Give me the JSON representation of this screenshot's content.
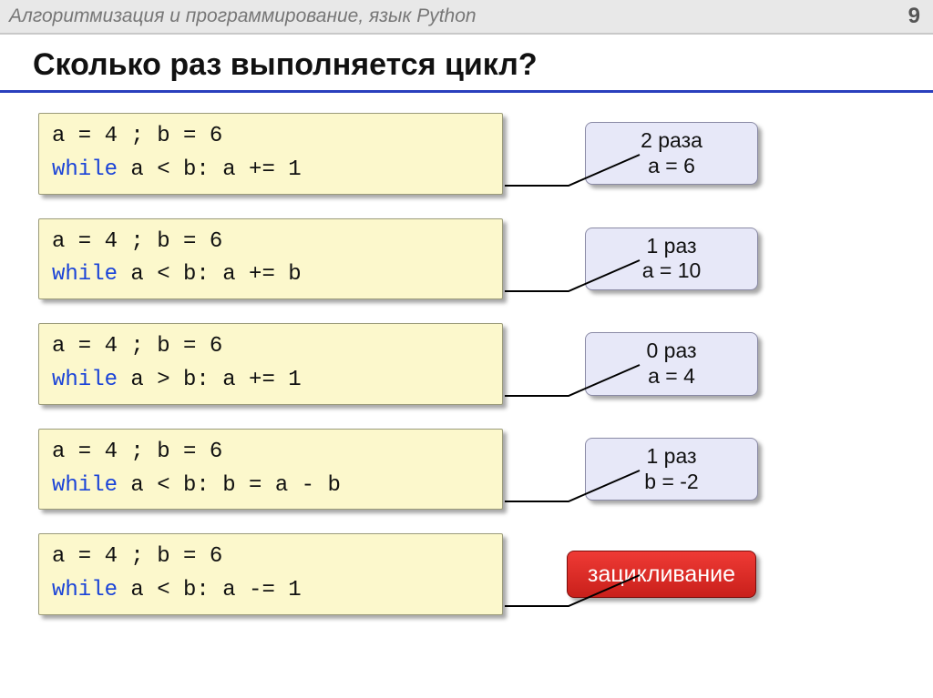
{
  "header": {
    "breadcrumb": "Алгоритмизация и программирование, язык Python",
    "page_number": "9"
  },
  "title": "Сколько раз выполняется цикл?",
  "rows": [
    {
      "code_line1_parts": [
        "a = 4",
        " ; ",
        "b = 6"
      ],
      "code_line2_parts": [
        "while",
        " a < b: a += 1"
      ],
      "answer_line1": "2 раза",
      "answer_line2": "a = 6",
      "style": "normal"
    },
    {
      "code_line1_parts": [
        "a = 4",
        " ; ",
        "b = 6"
      ],
      "code_line2_parts": [
        "while",
        " a < b: a += b"
      ],
      "answer_line1": "1 раз",
      "answer_line2": "a = 10",
      "style": "normal"
    },
    {
      "code_line1_parts": [
        "a = 4",
        " ; ",
        "b = 6"
      ],
      "code_line2_parts": [
        "while",
        " a > b: a += 1"
      ],
      "answer_line1": "0 раз",
      "answer_line2": "a = 4",
      "style": "normal"
    },
    {
      "code_line1_parts": [
        "a = 4",
        " ; ",
        "b = 6"
      ],
      "code_line2_parts": [
        "while",
        " a < b: b = a - b"
      ],
      "answer_line1": "1 раз",
      "answer_line2": "b = -2",
      "style": "normal"
    },
    {
      "code_line1_parts": [
        "a = 4",
        " ; ",
        "b = 6"
      ],
      "code_line2_parts": [
        "while",
        " a < b: a -= 1"
      ],
      "answer_line1": "зацикливание",
      "answer_line2": "",
      "style": "red"
    }
  ]
}
